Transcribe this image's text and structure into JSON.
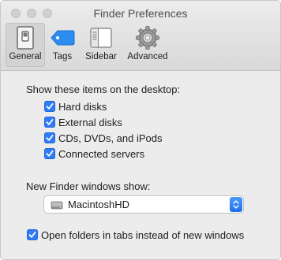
{
  "window": {
    "title": "Finder Preferences"
  },
  "toolbar": {
    "items": [
      {
        "label": "General",
        "icon": "general-switch-icon",
        "selected": true
      },
      {
        "label": "Tags",
        "icon": "tag-icon",
        "selected": false
      },
      {
        "label": "Sidebar",
        "icon": "sidebar-icon",
        "selected": false
      },
      {
        "label": "Advanced",
        "icon": "gear-icon",
        "selected": false
      }
    ]
  },
  "desktop": {
    "heading": "Show these items on the desktop:",
    "items": [
      {
        "label": "Hard disks",
        "checked": true
      },
      {
        "label": "External disks",
        "checked": true
      },
      {
        "label": "CDs, DVDs, and iPods",
        "checked": true
      },
      {
        "label": "Connected servers",
        "checked": true
      }
    ]
  },
  "new_window": {
    "label": "New Finder windows show:",
    "selected": "MacintoshHD",
    "icon": "hard-drive-icon"
  },
  "tabs_option": {
    "label": "Open folders in tabs instead of new windows",
    "checked": true
  },
  "colors": {
    "accent": "#2f7cf6",
    "tag_blue": "#2d8cf0"
  }
}
